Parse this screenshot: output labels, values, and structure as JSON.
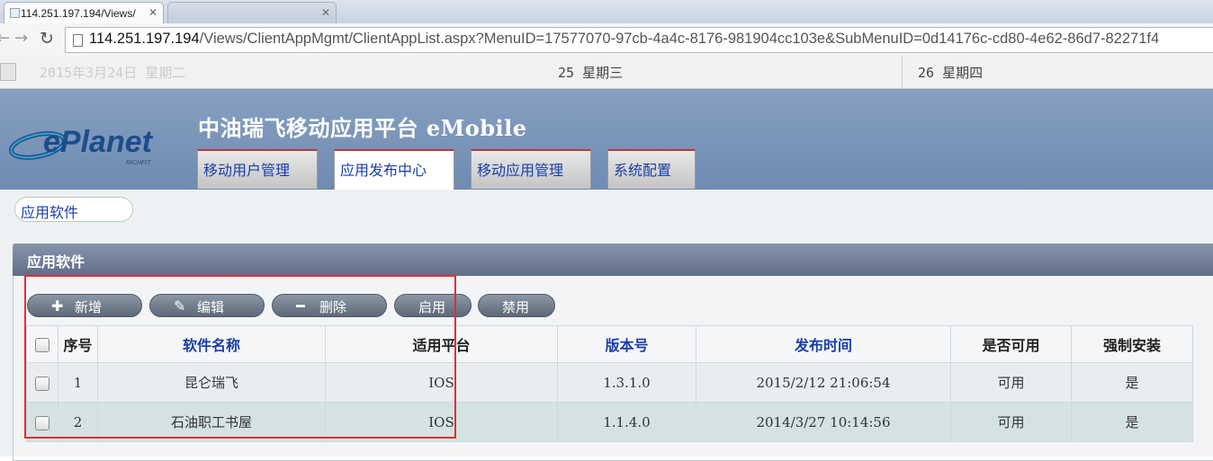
{
  "browser": {
    "active_tab_title": "114.251.197.194/Views/",
    "inactive_tab_title": "",
    "url_host": "114.251.197.194",
    "url_path": "/Views/ClientAppMgmt/ClientAppList.aspx?MenuID=17577070-97cb-4a4c-8176-981904cc103e&SubMenuID=0d14176c-cd80-4e62-86d7-82271f4"
  },
  "datestrip": {
    "d1": "2015年3月24日 星期二",
    "d2": "25 星期三",
    "d3": "26 星期四"
  },
  "app": {
    "title": "中油瑞飞移动应用平台 eMobile",
    "logo_text": "ePlanet",
    "logo_sub": "RICHFIT"
  },
  "nav_tabs": [
    {
      "label": "移动用户管理",
      "active": false
    },
    {
      "label": "应用发布中心",
      "active": true
    },
    {
      "label": "移动应用管理",
      "active": false
    },
    {
      "label": "系统配置",
      "active": false
    }
  ],
  "breadcrumb": "应用软件",
  "panel": {
    "title": "应用软件"
  },
  "toolbar": {
    "add": "新增",
    "edit": "编辑",
    "delete": "删除",
    "enable": "启用",
    "disable": "禁用"
  },
  "grid": {
    "headers": [
      "序号",
      "软件名称",
      "适用平台",
      "版本号",
      "发布时间",
      "是否可用",
      "强制安装"
    ],
    "rows": [
      {
        "no": "1",
        "name": "昆仑瑞飞",
        "platform": "IOS",
        "version": "1.3.1.0",
        "time": "2015/2/12 21:06:54",
        "available": "可用",
        "force": "是"
      },
      {
        "no": "2",
        "name": "石油职工书屋",
        "platform": "IOS",
        "version": "1.1.4.0",
        "time": "2014/3/27 10:14:56",
        "available": "可用",
        "force": "是"
      }
    ]
  },
  "colors": {
    "header_blue": "#7690b6",
    "link_blue": "#1a3eaa",
    "highlight_red": "#e03030"
  }
}
